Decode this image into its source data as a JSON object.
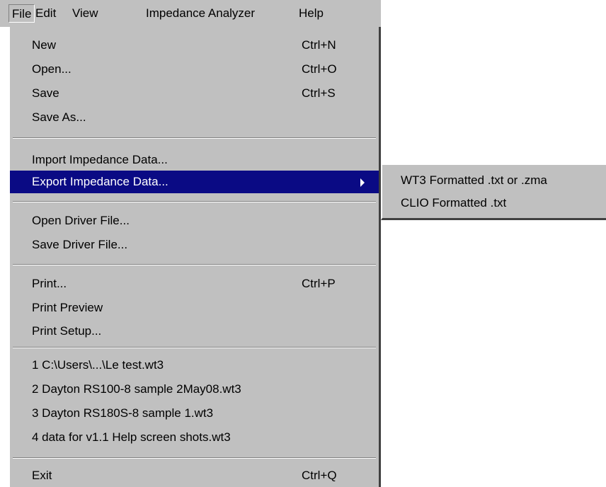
{
  "menubar": {
    "items": [
      {
        "label": "File"
      },
      {
        "label": "Edit"
      },
      {
        "label": "View"
      },
      {
        "label": "Impedance Analyzer"
      },
      {
        "label": "Help"
      }
    ],
    "open_menu": "File"
  },
  "file_menu": {
    "new": {
      "label": "New",
      "shortcut": "Ctrl+N"
    },
    "open": {
      "label": "Open...",
      "shortcut": "Ctrl+O"
    },
    "save": {
      "label": "Save",
      "shortcut": "Ctrl+S"
    },
    "save_as": {
      "label": "Save As..."
    },
    "import_impedance": {
      "label": "Import Impedance Data..."
    },
    "export_impedance": {
      "label": "Export Impedance Data...",
      "selected": true
    },
    "open_driver": {
      "label": "Open Driver File..."
    },
    "save_driver": {
      "label": "Save Driver File..."
    },
    "print": {
      "label": "Print...",
      "shortcut": "Ctrl+P"
    },
    "print_preview": {
      "label": "Print Preview"
    },
    "print_setup": {
      "label": "Print Setup..."
    },
    "recent_files": [
      {
        "label": "1 C:\\Users\\...\\Le test.wt3"
      },
      {
        "label": "2 Dayton RS100-8 sample 2May08.wt3"
      },
      {
        "label": "3 Dayton RS180S-8 sample 1.wt3"
      },
      {
        "label": "4 data for v1.1 Help screen shots.wt3"
      }
    ],
    "exit": {
      "label": "Exit",
      "shortcut": "Ctrl+Q"
    }
  },
  "export_submenu": {
    "items": [
      {
        "label": "WT3 Formatted .txt or .zma"
      },
      {
        "label": "CLIO Formatted .txt"
      }
    ]
  },
  "colors": {
    "menu_background": "#c0c0c0",
    "selection_background": "#0a0a84",
    "selection_text": "#ffffff"
  }
}
